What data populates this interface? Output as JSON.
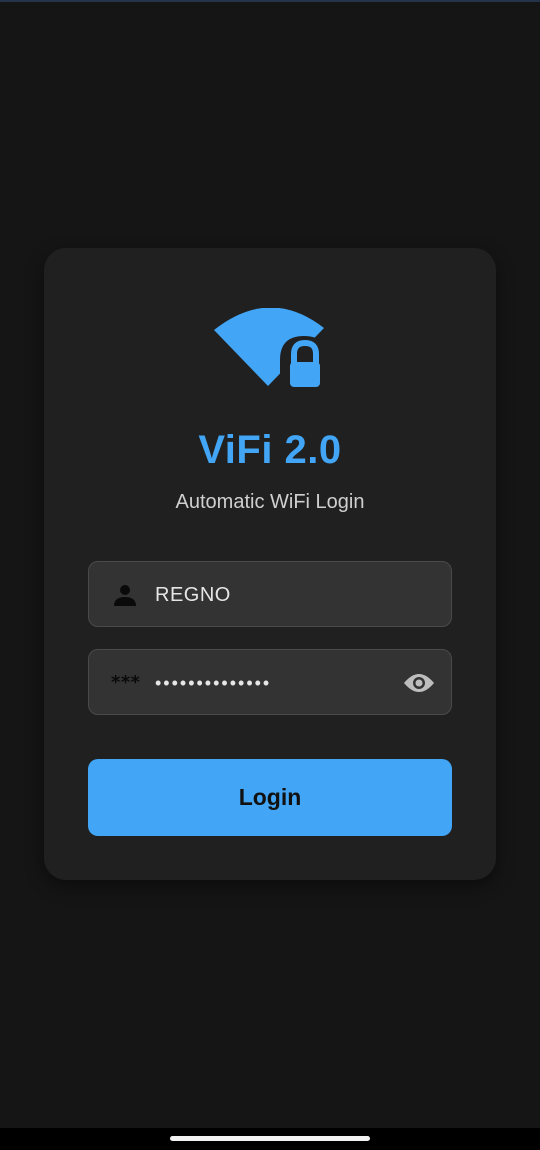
{
  "app": {
    "title": "ViFi 2.0",
    "subtitle": "Automatic WiFi Login"
  },
  "form": {
    "username": {
      "value": "REGNO",
      "icon": "person-icon"
    },
    "password": {
      "value": "••••••••••••••",
      "icon": "asterisk-icon",
      "lead_glyph": "***",
      "toggle_icon": "eye-icon"
    },
    "login_label": "Login"
  },
  "colors": {
    "accent": "#42a5f5",
    "background": "#151515",
    "card": "#202020",
    "field": "#333333"
  }
}
